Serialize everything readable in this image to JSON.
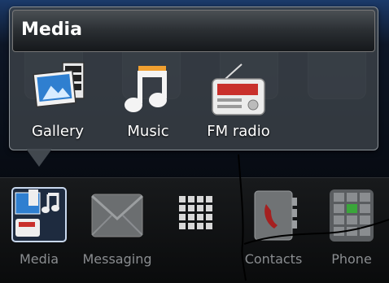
{
  "popup": {
    "title": "Media",
    "apps": [
      {
        "label": "Gallery",
        "icon": "gallery-icon"
      },
      {
        "label": "Music",
        "icon": "music-icon"
      },
      {
        "label": "FM radio",
        "icon": "fm-radio-icon"
      }
    ]
  },
  "dock": {
    "items": [
      {
        "label": "Media",
        "icon": "media-folder-icon"
      },
      {
        "label": "Messaging",
        "icon": "envelope-icon"
      },
      {
        "label": "",
        "icon": "app-grid-icon"
      },
      {
        "label": "Contacts",
        "icon": "contacts-book-icon"
      },
      {
        "label": "Phone",
        "icon": "dialpad-icon"
      }
    ]
  },
  "colors": {
    "accent_green": "#3aa63a",
    "label_gray": "#8a8d90"
  }
}
